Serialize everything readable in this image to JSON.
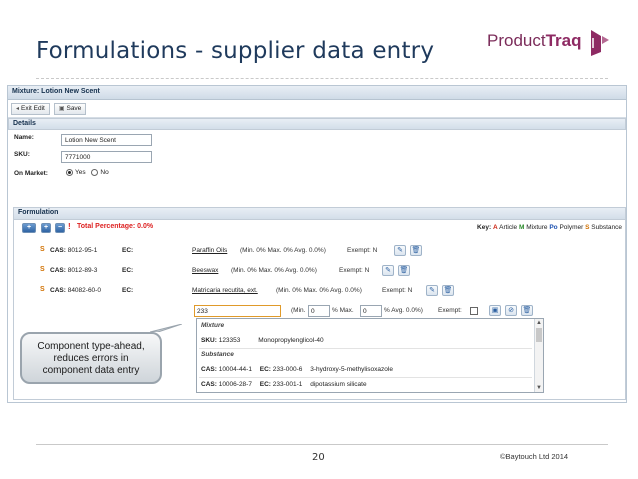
{
  "slide": {
    "title": "Formulations - supplier data entry",
    "logo_text_a": "Product",
    "logo_text_b": "Traq",
    "page_number": "20",
    "copyright": "©Baytouch Ltd 2014"
  },
  "app": {
    "mixture_title": "Mixture: Lotion New Scent",
    "toolbar": {
      "exit_label": "Exit Edit",
      "save_label": "Save"
    },
    "details": {
      "header": "Details",
      "name_label": "Name:",
      "name_value": "Lotion New Scent",
      "sku_label": "SKU:",
      "sku_value": "7771000",
      "market_label": "On Market:",
      "yes_label": "Yes",
      "no_label": "No",
      "on_market": "Yes"
    },
    "formulation": {
      "header": "Formulation",
      "total_label": "Total Percentage: 0.0%",
      "key": {
        "label": "Key:",
        "article_code": "A",
        "article_label": "Article",
        "mixture_code": "M",
        "mixture_label": "Mixture",
        "polymer_code": "Po",
        "polymer_label": "Polymer",
        "substance_code": "S",
        "substance_label": "Substance"
      },
      "rows": [
        {
          "type": "S",
          "cas_label": "CAS:",
          "cas": "8012-95-1",
          "ec_label": "EC:",
          "name": "Paraffin Oils",
          "stats": "(Min. 0% Max. 0% Avg. 0.0%)",
          "exempt": "Exempt: N"
        },
        {
          "type": "S",
          "cas_label": "CAS:",
          "cas": "8012-89-3",
          "ec_label": "EC:",
          "name": "Beeswax",
          "stats": "(Min. 0% Max. 0% Avg. 0.0%)",
          "exempt": "Exempt: N"
        },
        {
          "type": "S",
          "cas_label": "CAS:",
          "cas": "84082-60-0",
          "ec_label": "EC:",
          "name": "Matricaria recutita, ext.",
          "stats": "(Min. 0% Max. 0% Avg. 0.0%)",
          "exempt": "Exempt: N"
        }
      ],
      "entry": {
        "search_value": "233",
        "min_label": "(Min.",
        "min_value": "0",
        "max_label": "% Max.",
        "max_value": "0",
        "avg_label": "% Avg. 0.0%)",
        "exempt_label": "Exempt:"
      },
      "typeahead": {
        "mixture_heading": "Mixture",
        "mixture_item": {
          "sku_label": "SKU:",
          "sku": "123353",
          "name": "Monopropylenglicol-40"
        },
        "substance_heading": "Substance",
        "substances": [
          {
            "cas_label": "CAS:",
            "cas": "10004-44-1",
            "ec_label": "EC:",
            "ec": "233-000-6",
            "name": "3-hydroxy-5-methylisoxazole"
          },
          {
            "cas_label": "CAS:",
            "cas": "10006-28-7",
            "ec_label": "EC:",
            "ec": "233-001-1",
            "name": "dipotassium silicate"
          }
        ]
      }
    }
  },
  "callout": {
    "line1": "Component type-ahead,",
    "line2": "reduces errors in",
    "line3": "component data entry"
  }
}
